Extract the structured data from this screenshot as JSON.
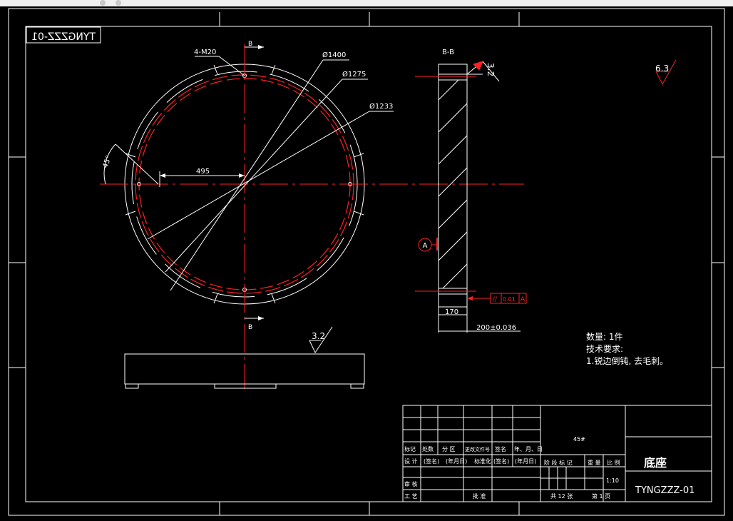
{
  "colors": {
    "background": "#000000",
    "line": "#ffffff",
    "center": "#ff2020",
    "hatch": "#ffffff"
  },
  "drawing_number_mirrored": "TYNGZZZ-01",
  "front_view": {
    "labels": {
      "bolt": "4-M20",
      "d1400": "Ø1400",
      "d1275": "Ø1275",
      "d1233": "Ø1233",
      "dim495": "495",
      "angle45": "45°",
      "section_top": "B",
      "section_bottom": "B"
    }
  },
  "section_view": {
    "title": "B-B",
    "roughness_top": "3.2",
    "datum": "A",
    "dim170": "170",
    "dim200": "200±0.036",
    "tolerance_symbol": "//",
    "tolerance_value": "0.01",
    "tolerance_datum": "A"
  },
  "roughness_general": "6.3",
  "roughness_bottom": "3.2",
  "notes": {
    "qty": "数量: 1件",
    "tech_title": "技术要求:",
    "tech_1": "1.锐边倒钝, 去毛刺。"
  },
  "title_block": {
    "material": "45#",
    "part_name": "底座",
    "drawing_no": "TYNGZZZ-01",
    "scale": "1:10",
    "h_mark": "标记",
    "h_count": "处数",
    "h_zone": "分 区",
    "h_change": "更改文件号",
    "h_sign": "签名",
    "h_date": "年、月、日",
    "h_design": "设 计",
    "h_sig1": "(签名)",
    "h_date1": "(年月日)",
    "h_std": "标准化",
    "h_sig2": "(签名)",
    "h_date2": "(年月日)",
    "h_check": "审 核",
    "h_process": "工 艺",
    "h_approve": "批 准",
    "h_stage": "阶 段 标 记",
    "h_weight": "重 量",
    "h_ratio": "比 例",
    "h_total": "共 12 张",
    "h_sheet": "第 1 页"
  }
}
